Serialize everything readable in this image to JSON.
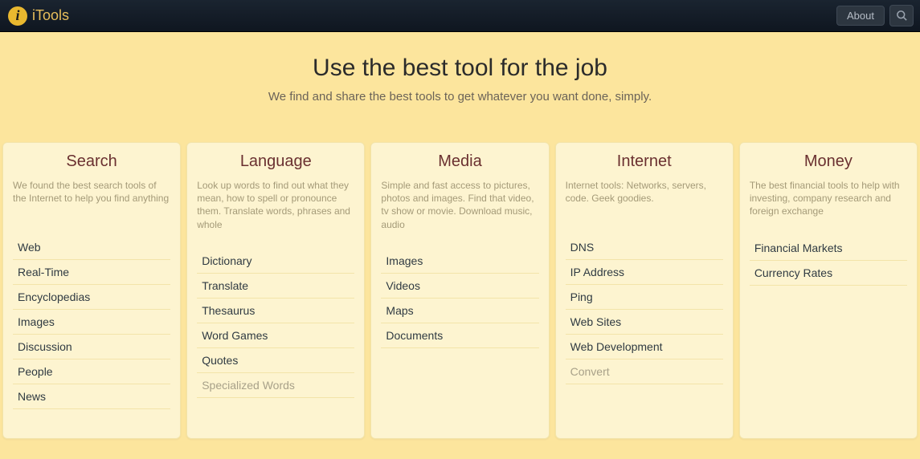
{
  "brand": {
    "name": "iTools"
  },
  "nav": {
    "about": "About"
  },
  "hero": {
    "title": "Use the best tool for the job",
    "subtitle": "We find and share the best tools to get whatever you want done, simply."
  },
  "cards": [
    {
      "title": "Search",
      "desc": "We found the best search tools of the Internet to help you find anything",
      "items": [
        {
          "label": "Web"
        },
        {
          "label": "Real-Time"
        },
        {
          "label": "Encyclopedias"
        },
        {
          "label": "Images"
        },
        {
          "label": "Discussion"
        },
        {
          "label": "People"
        },
        {
          "label": "News"
        }
      ]
    },
    {
      "title": "Language",
      "desc": "Look up words to find out what they mean, how to spell or pronounce them. Translate words, phrases and whole",
      "items": [
        {
          "label": "Dictionary"
        },
        {
          "label": "Translate"
        },
        {
          "label": "Thesaurus"
        },
        {
          "label": "Word Games"
        },
        {
          "label": "Quotes"
        },
        {
          "label": "Specialized Words",
          "muted": true
        }
      ]
    },
    {
      "title": "Media",
      "desc": "Simple and fast access to pictures, photos and images. Find that video, tv show or movie. Download music, audio",
      "items": [
        {
          "label": "Images"
        },
        {
          "label": "Videos"
        },
        {
          "label": "Maps"
        },
        {
          "label": "Documents"
        }
      ]
    },
    {
      "title": "Internet",
      "desc": "Internet tools: Networks, servers, code. Geek goodies.",
      "items": [
        {
          "label": "DNS"
        },
        {
          "label": "IP Address"
        },
        {
          "label": "Ping"
        },
        {
          "label": "Web Sites"
        },
        {
          "label": "Web Development"
        },
        {
          "label": "Convert",
          "muted": true
        }
      ]
    },
    {
      "title": "Money",
      "desc": "The best financial tools to help with investing, company research and foreign exchange",
      "items": [
        {
          "label": "Financial Markets"
        },
        {
          "label": "Currency Rates"
        }
      ]
    }
  ]
}
